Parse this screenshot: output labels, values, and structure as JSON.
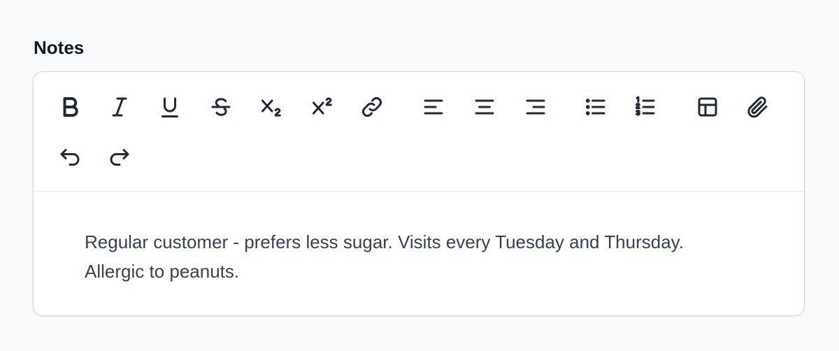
{
  "field": {
    "label": "Notes"
  },
  "toolbar": {
    "buttons": [
      {
        "name": "bold-icon"
      },
      {
        "name": "italic-icon"
      },
      {
        "name": "underline-icon"
      },
      {
        "name": "strikethrough-icon"
      },
      {
        "name": "subscript-icon"
      },
      {
        "name": "superscript-icon"
      },
      {
        "name": "link-icon"
      },
      {
        "name": "align-left-icon"
      },
      {
        "name": "align-center-icon"
      },
      {
        "name": "align-right-icon"
      },
      {
        "name": "bullet-list-icon"
      },
      {
        "name": "ordered-list-icon"
      },
      {
        "name": "table-icon"
      },
      {
        "name": "attachment-icon"
      },
      {
        "name": "undo-icon"
      },
      {
        "name": "redo-icon"
      }
    ]
  },
  "editor": {
    "content": "Regular customer - prefers less sugar. Visits every Tuesday and Thursday. Allergic to peanuts."
  },
  "colors": {
    "background": "#f9fafb",
    "icon": "#1f2937",
    "text": "#374151",
    "border": "#d1d5db"
  }
}
